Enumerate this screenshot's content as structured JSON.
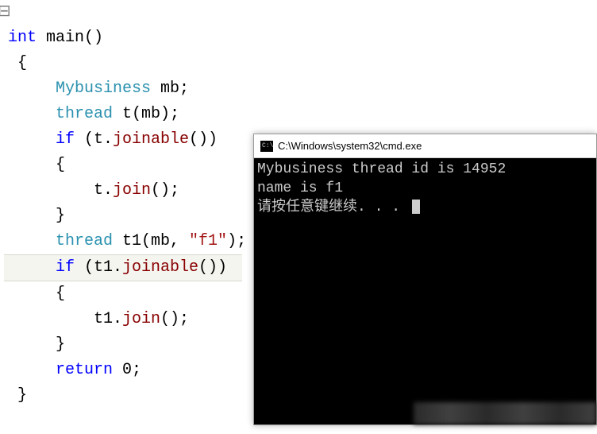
{
  "code": {
    "line1_kw": "int",
    "line1_rest": " main()",
    "line2": " {",
    "line3_type": "     Mybusiness",
    "line3_rest": " mb;",
    "line4_type": "     thread",
    "line4_rest": " t(mb);",
    "line5_if": "     if",
    "line5_rest1": " (t.",
    "line5_func": "joinable",
    "line5_rest2": "())",
    "line6": "     {",
    "line7_rest1": "         t.",
    "line7_func": "join",
    "line7_rest2": "();",
    "line8": "     }",
    "line9_type": "     thread",
    "line9_rest1": " t1(mb, ",
    "line9_str": "\"f1\"",
    "line9_rest2": ");",
    "line10_if": "     if",
    "line10_rest1": " (t1.",
    "line10_func": "joinable",
    "line10_rest2": "())",
    "line11": "     {",
    "line12_rest1": "         t1.",
    "line12_func": "join",
    "line12_rest2": "();",
    "line13": "     }",
    "line14_ret": "     return",
    "line14_rest": " 0;",
    "line15": " }"
  },
  "console": {
    "title": "C:\\Windows\\system32\\cmd.exe",
    "icon_label": "C:\\",
    "output_line1": "Mybusiness thread id is 14952",
    "output_line2": "name is f1",
    "output_line3": "请按任意键继续. . . "
  }
}
